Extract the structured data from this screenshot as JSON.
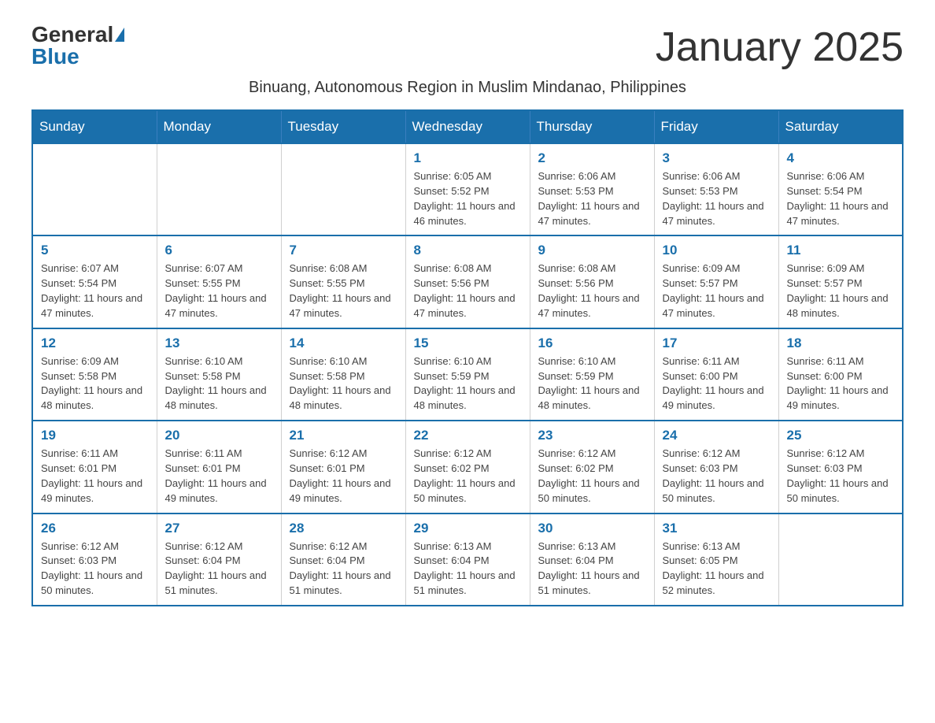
{
  "header": {
    "logo_general": "General",
    "logo_blue": "Blue",
    "month_title": "January 2025",
    "subtitle": "Binuang, Autonomous Region in Muslim Mindanao, Philippines"
  },
  "days_of_week": [
    "Sunday",
    "Monday",
    "Tuesday",
    "Wednesday",
    "Thursday",
    "Friday",
    "Saturday"
  ],
  "weeks": [
    [
      {
        "day": "",
        "info": ""
      },
      {
        "day": "",
        "info": ""
      },
      {
        "day": "",
        "info": ""
      },
      {
        "day": "1",
        "info": "Sunrise: 6:05 AM\nSunset: 5:52 PM\nDaylight: 11 hours and 46 minutes."
      },
      {
        "day": "2",
        "info": "Sunrise: 6:06 AM\nSunset: 5:53 PM\nDaylight: 11 hours and 47 minutes."
      },
      {
        "day": "3",
        "info": "Sunrise: 6:06 AM\nSunset: 5:53 PM\nDaylight: 11 hours and 47 minutes."
      },
      {
        "day": "4",
        "info": "Sunrise: 6:06 AM\nSunset: 5:54 PM\nDaylight: 11 hours and 47 minutes."
      }
    ],
    [
      {
        "day": "5",
        "info": "Sunrise: 6:07 AM\nSunset: 5:54 PM\nDaylight: 11 hours and 47 minutes."
      },
      {
        "day": "6",
        "info": "Sunrise: 6:07 AM\nSunset: 5:55 PM\nDaylight: 11 hours and 47 minutes."
      },
      {
        "day": "7",
        "info": "Sunrise: 6:08 AM\nSunset: 5:55 PM\nDaylight: 11 hours and 47 minutes."
      },
      {
        "day": "8",
        "info": "Sunrise: 6:08 AM\nSunset: 5:56 PM\nDaylight: 11 hours and 47 minutes."
      },
      {
        "day": "9",
        "info": "Sunrise: 6:08 AM\nSunset: 5:56 PM\nDaylight: 11 hours and 47 minutes."
      },
      {
        "day": "10",
        "info": "Sunrise: 6:09 AM\nSunset: 5:57 PM\nDaylight: 11 hours and 47 minutes."
      },
      {
        "day": "11",
        "info": "Sunrise: 6:09 AM\nSunset: 5:57 PM\nDaylight: 11 hours and 48 minutes."
      }
    ],
    [
      {
        "day": "12",
        "info": "Sunrise: 6:09 AM\nSunset: 5:58 PM\nDaylight: 11 hours and 48 minutes."
      },
      {
        "day": "13",
        "info": "Sunrise: 6:10 AM\nSunset: 5:58 PM\nDaylight: 11 hours and 48 minutes."
      },
      {
        "day": "14",
        "info": "Sunrise: 6:10 AM\nSunset: 5:58 PM\nDaylight: 11 hours and 48 minutes."
      },
      {
        "day": "15",
        "info": "Sunrise: 6:10 AM\nSunset: 5:59 PM\nDaylight: 11 hours and 48 minutes."
      },
      {
        "day": "16",
        "info": "Sunrise: 6:10 AM\nSunset: 5:59 PM\nDaylight: 11 hours and 48 minutes."
      },
      {
        "day": "17",
        "info": "Sunrise: 6:11 AM\nSunset: 6:00 PM\nDaylight: 11 hours and 49 minutes."
      },
      {
        "day": "18",
        "info": "Sunrise: 6:11 AM\nSunset: 6:00 PM\nDaylight: 11 hours and 49 minutes."
      }
    ],
    [
      {
        "day": "19",
        "info": "Sunrise: 6:11 AM\nSunset: 6:01 PM\nDaylight: 11 hours and 49 minutes."
      },
      {
        "day": "20",
        "info": "Sunrise: 6:11 AM\nSunset: 6:01 PM\nDaylight: 11 hours and 49 minutes."
      },
      {
        "day": "21",
        "info": "Sunrise: 6:12 AM\nSunset: 6:01 PM\nDaylight: 11 hours and 49 minutes."
      },
      {
        "day": "22",
        "info": "Sunrise: 6:12 AM\nSunset: 6:02 PM\nDaylight: 11 hours and 50 minutes."
      },
      {
        "day": "23",
        "info": "Sunrise: 6:12 AM\nSunset: 6:02 PM\nDaylight: 11 hours and 50 minutes."
      },
      {
        "day": "24",
        "info": "Sunrise: 6:12 AM\nSunset: 6:03 PM\nDaylight: 11 hours and 50 minutes."
      },
      {
        "day": "25",
        "info": "Sunrise: 6:12 AM\nSunset: 6:03 PM\nDaylight: 11 hours and 50 minutes."
      }
    ],
    [
      {
        "day": "26",
        "info": "Sunrise: 6:12 AM\nSunset: 6:03 PM\nDaylight: 11 hours and 50 minutes."
      },
      {
        "day": "27",
        "info": "Sunrise: 6:12 AM\nSunset: 6:04 PM\nDaylight: 11 hours and 51 minutes."
      },
      {
        "day": "28",
        "info": "Sunrise: 6:12 AM\nSunset: 6:04 PM\nDaylight: 11 hours and 51 minutes."
      },
      {
        "day": "29",
        "info": "Sunrise: 6:13 AM\nSunset: 6:04 PM\nDaylight: 11 hours and 51 minutes."
      },
      {
        "day": "30",
        "info": "Sunrise: 6:13 AM\nSunset: 6:04 PM\nDaylight: 11 hours and 51 minutes."
      },
      {
        "day": "31",
        "info": "Sunrise: 6:13 AM\nSunset: 6:05 PM\nDaylight: 11 hours and 52 minutes."
      },
      {
        "day": "",
        "info": ""
      }
    ]
  ]
}
